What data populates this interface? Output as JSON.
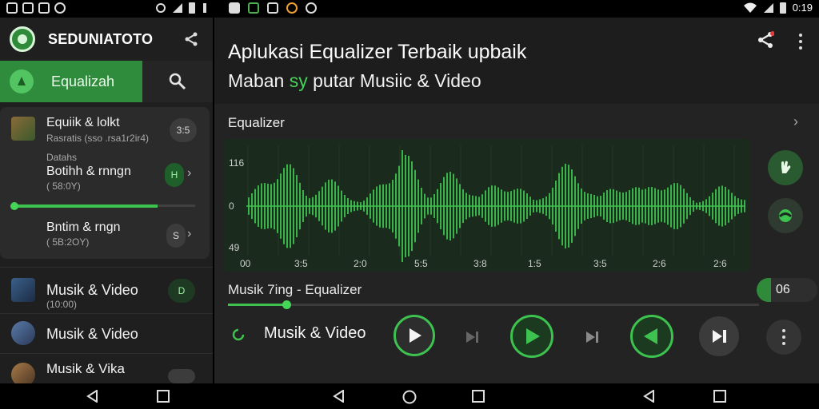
{
  "status_bar": {
    "time": "0:19"
  },
  "sidebar": {
    "app_title": "SEDUNIATOTO",
    "eq_tab_label": "Equalizah",
    "card": {
      "row1": {
        "title": "Equiik & lolkt",
        "sub": "Rasratis (sso .rsa1r2ir4)",
        "pill": "3:5"
      },
      "row2": {
        "top": "Datahs",
        "title": "Botihh & rnngn",
        "sub": "( 58:0Y)",
        "pill": "H"
      },
      "row2_slider_progress": 0.79,
      "row3": {
        "title": "Bntim & rngn",
        "sub": "( 5B:2OY)",
        "pill": "S"
      }
    },
    "list": [
      {
        "title": "Musik & Video",
        "sub": "(10:00)",
        "pill": "D"
      },
      {
        "title": "Musik & Video",
        "sub": ""
      },
      {
        "title": "Musik & Vika",
        "sub": ""
      }
    ]
  },
  "main": {
    "title": "Aplukasi Equalizer Terbaik upbaik",
    "subtitle_pre": "Maban ",
    "subtitle_accent": "sy",
    "subtitle_post": " putar Musiic & Video",
    "equalizer_label": "Equalizer",
    "wave": {
      "y_labels": [
        "116",
        "0",
        "49"
      ],
      "x_labels": [
        "00",
        "3:5",
        "2:0",
        "5:5",
        "3:8",
        "1:5",
        "3:5",
        "2:6",
        "2:6"
      ]
    },
    "now_playing_label": "Musik 7ing - Equalizer",
    "now_badge": "06",
    "progress": 0.11,
    "control_label": "Musik & Video"
  },
  "colors": {
    "accent": "#3ec24f",
    "panel": "#222322",
    "sidebar": "#1e1f1e"
  }
}
